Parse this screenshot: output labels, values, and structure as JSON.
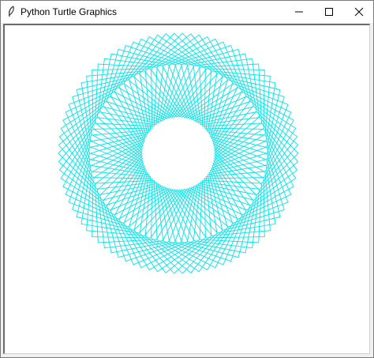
{
  "window": {
    "title": "Python Turtle Graphics",
    "icon": "feather-icon",
    "controls": [
      "minimize-icon",
      "maximize-icon",
      "close-icon"
    ]
  },
  "canvas": {
    "background": "#ffffff",
    "pen_color": "#00e5ee",
    "pattern": "spirograph of rotated squares"
  }
}
